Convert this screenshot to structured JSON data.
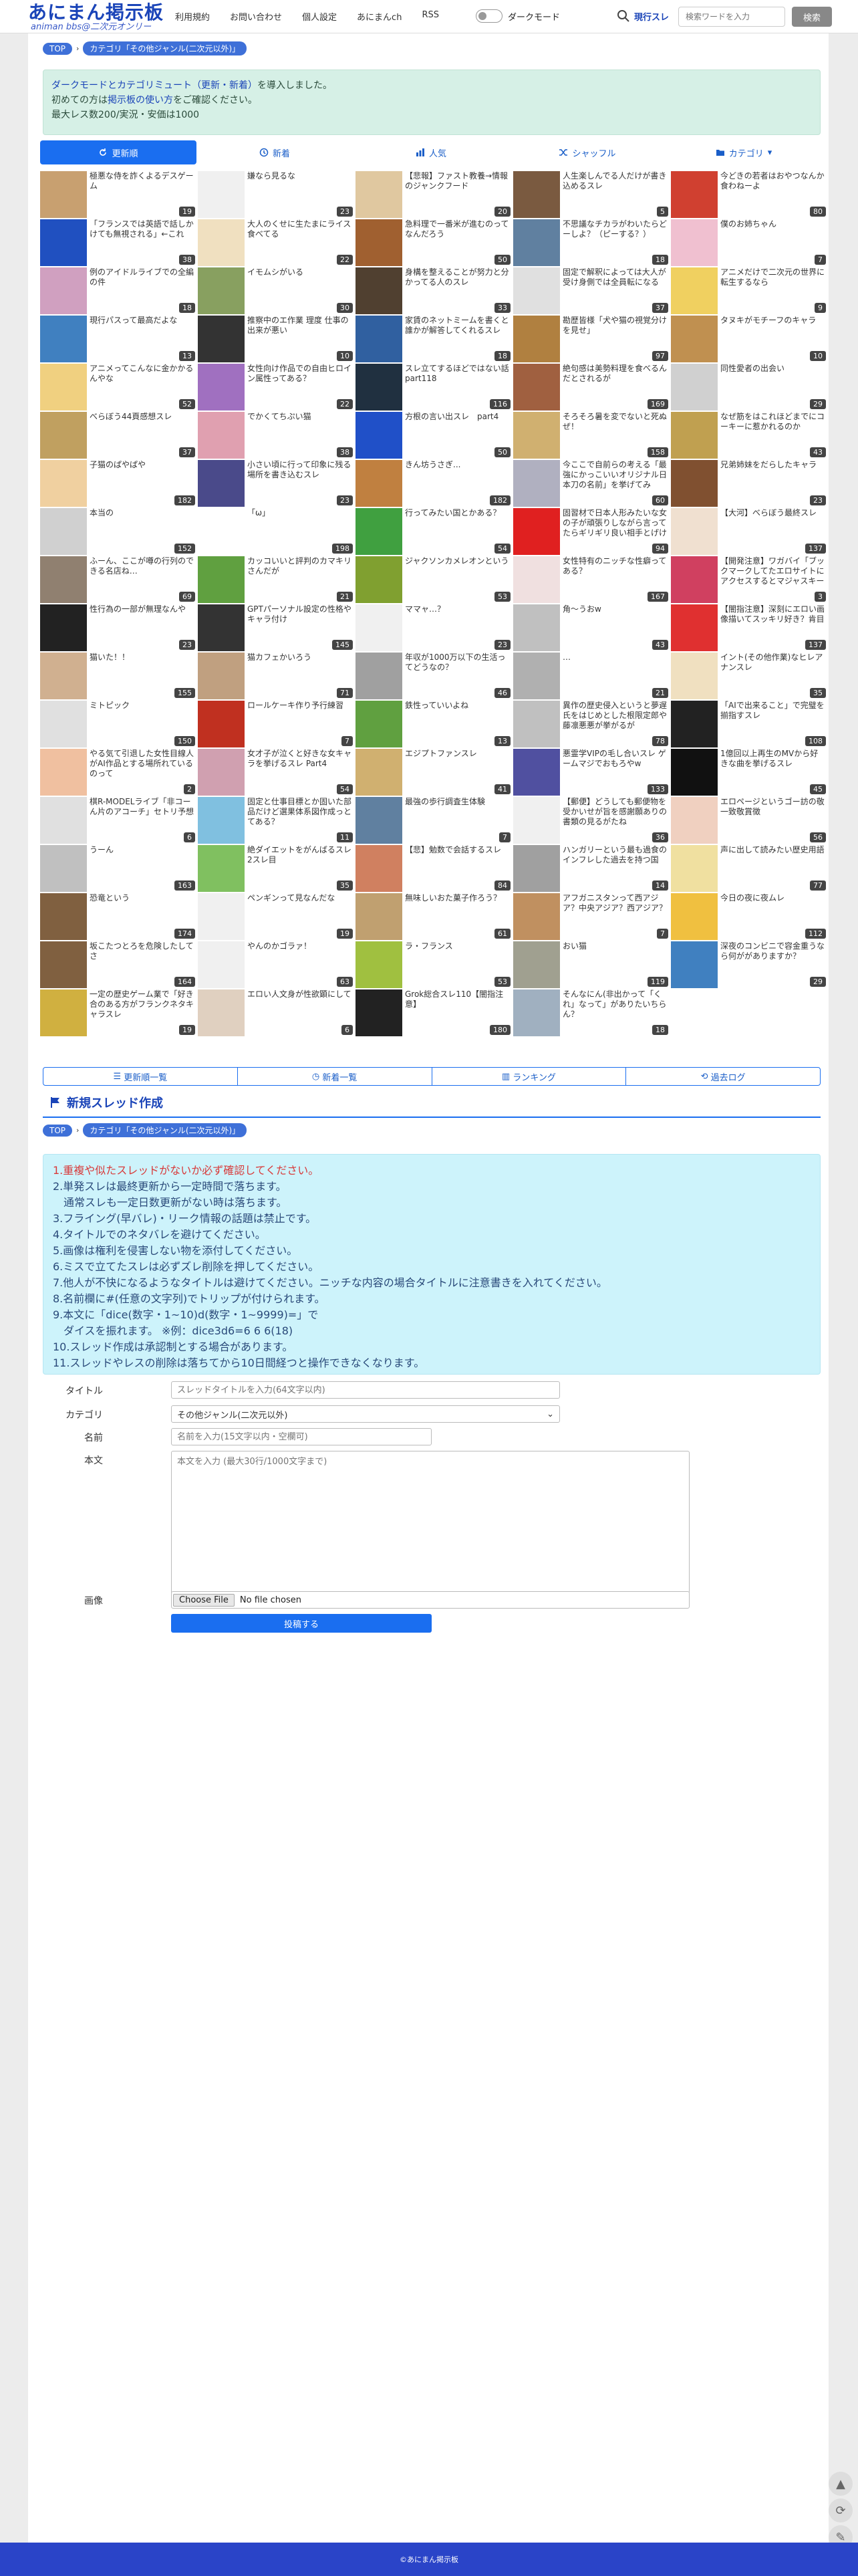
{
  "brand": {
    "title": "あにまん掲示板",
    "sub": "animan bbs@二次元オンリー"
  },
  "nav": {
    "items": [
      "利用規約",
      "お問い合わせ",
      "個人設定",
      "あにまんch",
      "RSS"
    ],
    "dark_label": "ダークモード"
  },
  "search": {
    "scope": "現行スレ",
    "placeholder": "検索ワードを入力",
    "button": "検索"
  },
  "breadcrumb": {
    "top": "TOP",
    "category": "カテゴリ「その他ジャンル(二次元以外)」"
  },
  "notice": {
    "line1_a": "ダークモードとカテゴリミュート（更新・新着）",
    "line1_b": "を導入しました。",
    "line2_a": "初めての方は",
    "line2_link": "掲示板の使い方",
    "line2_b": "をご確認ください。",
    "line3": "最大レス数200/実況・安価は1000"
  },
  "tabs": [
    "更新順",
    "新着",
    "人気",
    "シャッフル",
    "カテゴリ"
  ],
  "threads": [
    {
      "title": "極悪な侍を詐くよるデスゲーム",
      "count": "19",
      "color": "#c8a070"
    },
    {
      "title": "嫌なら見るな",
      "count": "23",
      "color": "#f0f0f0"
    },
    {
      "title": "【悲報】ファスト教養→情報のジャンクフード",
      "count": "20",
      "color": "#e0c8a0"
    },
    {
      "title": "人生楽しんでる人だけが書き込めるスレ",
      "count": "5",
      "color": "#7a5a40"
    },
    {
      "title": "今どきの若者はおやつなんか食わねーよ",
      "count": "80",
      "color": "#d04030"
    },
    {
      "title": "「フランスでは英語で話しかけても無視される」←これ",
      "count": "38",
      "color": "#2050c0"
    },
    {
      "title": "大人のくせに生たまにライス食べてる",
      "count": "22",
      "color": "#f0e0c0"
    },
    {
      "title": "急料理で一番米が進むのってなんだろう",
      "count": "50",
      "color": "#a06030"
    },
    {
      "title": "不思議なチカラがわいたらどーしよ？（ピーする？）",
      "count": "18",
      "color": "#6080a0"
    },
    {
      "title": "僕のお姉ちゃん",
      "count": "7",
      "color": "#f0c0d0"
    },
    {
      "title": "例のアイドルライブでの全編の件",
      "count": "18",
      "color": "#d0a0c0"
    },
    {
      "title": "イモムシがいる",
      "count": "30",
      "color": "#88a060"
    },
    {
      "title": "身構を整えることが努力と分かってる人のスレ",
      "count": "33",
      "color": "#504030"
    },
    {
      "title": "固定で解釈によっては大人が受け身側では全員転になる",
      "count": "37",
      "color": "#e0e0e0"
    },
    {
      "title": "アニメだけで二次元の世界に転生するなら",
      "count": "9",
      "color": "#f0d060"
    },
    {
      "title": "現行パスって最高だよな",
      "count": "13",
      "color": "#4080c0"
    },
    {
      "title": "推察中のエ作業 理度 仕事の出来が悪い",
      "count": "10",
      "color": "#333333"
    },
    {
      "title": "家賃のネットミームを書くと誰かが解答してくれるスレ",
      "count": "18",
      "color": "#3060a0"
    },
    {
      "title": "勘歴皆様「犬や猫の視覚分けを見せ」",
      "count": "97",
      "color": "#b08040"
    },
    {
      "title": "タヌキがモチーフのキャラ",
      "count": "10",
      "color": "#c09050"
    },
    {
      "title": "アニメってこんなに金かかるんやな",
      "count": "52",
      "color": "#f0d080"
    },
    {
      "title": "女性向け作品での自由ヒロイン属性ってある？",
      "count": "22",
      "color": "#a070c0"
    },
    {
      "title": "スレ立てするほどではない話part118",
      "count": "116",
      "color": "#203040"
    },
    {
      "title": "絶句感は美勢料理を食べるんだとされるが",
      "count": "169",
      "color": "#a06040"
    },
    {
      "title": "同性愛者の出会い",
      "count": "29",
      "color": "#d0d0d0"
    },
    {
      "title": "べらぼう44頁感想スレ",
      "count": "37",
      "color": "#c0a060"
    },
    {
      "title": "でかくてちぷい猫",
      "count": "38",
      "color": "#e0a0b0"
    },
    {
      "title": "方根の言い出スレ　part4",
      "count": "50",
      "color": "#2050c8"
    },
    {
      "title": "そろそろ暑を変でないと死ぬぜ！",
      "count": "158",
      "color": "#d0b070"
    },
    {
      "title": "なぜ筋をはこれほどまでにコーキーに惹かれるのか",
      "count": "43",
      "color": "#c0a050"
    },
    {
      "title": "子猫のぱやぱや",
      "count": "182",
      "color": "#f0d0a0"
    },
    {
      "title": "小さい頃に行って印象に残る場所を書き込むスレ",
      "count": "23",
      "color": "#4a4a8a"
    },
    {
      "title": "きん坊うさぎ...",
      "count": "182",
      "color": "#c08040"
    },
    {
      "title": "今ここで自前らの考える「最強にかっこいいオリジナル日本刀の名前」を挙げてみ",
      "count": "60",
      "color": "#b0b0c0"
    },
    {
      "title": "兄弟姉妹をだらしたキャラ",
      "count": "23",
      "color": "#805030"
    },
    {
      "title": "本当の",
      "count": "152",
      "color": "#d0d0d0"
    },
    {
      "title": "「ω」",
      "count": "198",
      "color": "#ffffff"
    },
    {
      "title": "行ってみたい国とかある？",
      "count": "54",
      "color": "#40a040"
    },
    {
      "title": "固習材で日本人形みたいな女の子が頑張りしながら言ってたらギリギリ良い相手とげけ",
      "count": "94",
      "color": "#e02020"
    },
    {
      "title": "【大河】べらぼう最終スレ",
      "count": "137",
      "color": "#f0e0d0"
    },
    {
      "title": "ふーん、ここが噂の行列のできる名店ね…",
      "count": "69",
      "color": "#908070"
    },
    {
      "title": "カッコいいと評判のカマキリさんだが",
      "count": "21",
      "color": "#60a040"
    },
    {
      "title": "ジャクソンカメレオンという",
      "count": "53",
      "color": "#80a030"
    },
    {
      "title": "女性特有のニッチな性癖ってある？",
      "count": "167",
      "color": "#f0e0e0"
    },
    {
      "title": "【開発注意】ワガバイ「ブックマークしてたエロサイトにアクセスするとマジャスキーん」",
      "count": "3",
      "color": "#d04060"
    },
    {
      "title": "性行為の一部が無理なんや",
      "count": "23",
      "color": "#222222"
    },
    {
      "title": "GPTパーソナル設定の性格やキャラ付け",
      "count": "145",
      "color": "#333333"
    },
    {
      "title": "ママャ…？",
      "count": "23",
      "color": "#f0f0f0"
    },
    {
      "title": "角～うおw",
      "count": "43",
      "color": "#c0c0c0"
    },
    {
      "title": "【闇指注意】深刻にエロい画像描いてスッキリ好き？肯目",
      "count": "137",
      "color": "#e03030"
    },
    {
      "title": "猫いた！！",
      "count": "155",
      "color": "#d0b090"
    },
    {
      "title": "猫カフェかいろう",
      "count": "71",
      "color": "#c0a080"
    },
    {
      "title": "年収が1000万以下の生活ってどうなの？",
      "count": "46",
      "color": "#a0a0a0"
    },
    {
      "title": "…",
      "count": "21",
      "color": "#b0b0b0"
    },
    {
      "title": "イント(その他作業)なヒレアナンスレ",
      "count": "35",
      "color": "#f0e0c0"
    },
    {
      "title": "ミトピック",
      "count": "150",
      "color": "#e0e0e0"
    },
    {
      "title": "ロールケーキ作り予行練習",
      "count": "7",
      "color": "#c03020"
    },
    {
      "title": "鉄性っていいよね",
      "count": "13",
      "color": "#60a040"
    },
    {
      "title": "異作の歴史侵入というと夢遅氏をはじめとした根限定郎や藤凛悪悪が挙がるが",
      "count": "78",
      "color": "#c0c0c0"
    },
    {
      "title": "「AIで出来ること」で完璧を揃指すスレ",
      "count": "108",
      "color": "#222222"
    },
    {
      "title": "やる気て引退した女性目線人がAI作品とする場所れているのって",
      "count": "2",
      "color": "#f0c0a0"
    },
    {
      "title": "女才子が泣くと好きな女キャラを挙げるスレ Part4",
      "count": "54",
      "color": "#d0a0b0"
    },
    {
      "title": "エジプトファンスレ",
      "count": "41",
      "color": "#d0b070"
    },
    {
      "title": "悪霊学VIPの毛し合いスレ ゲームマジでおもろやw",
      "count": "133",
      "color": "#5050a0"
    },
    {
      "title": "1億回以上再生のMVから好きな曲を挙げるスレ",
      "count": "45",
      "color": "#111111"
    },
    {
      "title": "棋R-MODELライブ「非コーん片のアコーチ」セトリ予想",
      "count": "6",
      "color": "#e0e0e0"
    },
    {
      "title": "固定と仕事目標とか固いた部品だけど選果体系図作成っとてある？",
      "count": "11",
      "color": "#80c0e0"
    },
    {
      "title": "最強の歩行調査生体験",
      "count": "7",
      "color": "#6080a0"
    },
    {
      "title": "【郵便】どうしても郵便物を受かいせが旨を感謝願ありの書類の見るがたね",
      "count": "36",
      "color": "#f0f0f0"
    },
    {
      "title": "エロページというゴー訪の敬一致敬賞徴",
      "count": "56",
      "color": "#f0d0c0"
    },
    {
      "title": "うーん",
      "count": "163",
      "color": "#c0c0c0"
    },
    {
      "title": "絶ダイエットをがんばるスレ　2スレ目",
      "count": "35",
      "color": "#80c060"
    },
    {
      "title": "【悲】勉数で会話するスレ",
      "count": "84",
      "color": "#d08060"
    },
    {
      "title": "ハンガリーという最も過食のインフレした過去を持つ国",
      "count": "14",
      "color": "#a0a0a0"
    },
    {
      "title": "声に出して読みたい歴史用語",
      "count": "77",
      "color": "#f0e0a0"
    },
    {
      "title": "恐竜という",
      "count": "174",
      "color": "#806040"
    },
    {
      "title": "ペンギンって見なんだな",
      "count": "19",
      "color": "#f0f0f0"
    },
    {
      "title": "無味しいおた菓子作ろう？",
      "count": "61",
      "color": "#c0a070"
    },
    {
      "title": "アフガニスタンって西アジア？中央アジア？西アジア？",
      "count": "7",
      "color": "#c09060"
    },
    {
      "title": "今日の夜に夜ムレ",
      "count": "112",
      "color": "#f0c040"
    },
    {
      "title": "坂こたつとろを危険したしてさ",
      "count": "164",
      "color": "#806040"
    },
    {
      "title": "やんのかゴラァ！",
      "count": "63",
      "color": "#f0f0f0"
    },
    {
      "title": "ラ・フランス",
      "count": "53",
      "color": "#a0c040"
    },
    {
      "title": "おい猫",
      "count": "119",
      "color": "#a0a090"
    },
    {
      "title": "深夜のコンビニで容金重うなら何ががありますか？",
      "count": "29",
      "color": "#4080c0"
    },
    {
      "title": "一定の歴史ゲーム業で「好き合のある方がフランクネタキャラスレ",
      "count": "19",
      "color": "#d0b040"
    },
    {
      "title": "エロい人文身が性欲顕にして",
      "count": "6",
      "color": "#e0d0c0"
    },
    {
      "title": "Grok総合スレ110【闇指注意】",
      "count": "180",
      "color": "#222222"
    },
    {
      "title": "そんなにん(非出かって「くれ」なって」がありたいちらん？",
      "count": "18",
      "color": "#a0b0c0"
    }
  ],
  "subnav": [
    "更新順一覧",
    "新着一覧",
    "ランキング",
    "過去ログ"
  ],
  "new_thread": {
    "heading": "新規スレッド作成"
  },
  "rules": [
    {
      "text": "1.重複や似たスレッドがないか必ず確認してください。",
      "red": true
    },
    {
      "text": "2.単発スレは最終更新から一定時間で落ちます。",
      "red": false
    },
    {
      "text": "　通常スレも一定日数更新がない時は落ちます。",
      "red": false
    },
    {
      "text": "3.フライング(早バレ)・リーク情報の話題は禁止です。",
      "red": false
    },
    {
      "text": "4.タイトルでのネタバレを避けてください。",
      "red": false
    },
    {
      "text": "5.画像は権利を侵害しない物を添付してください。",
      "red": false
    },
    {
      "text": "6.ミスで立てたスレは必ずズレ削除を押してください。",
      "red": false
    },
    {
      "text": "7.他人が不快になるようなタイトルは避けてください。ニッチな内容の場合タイトルに注意書きを入れてください。",
      "red": false
    },
    {
      "text": "8.名前欄に#(任意の文字列)でトリップが付けられます。",
      "red": false
    },
    {
      "text": "9.本文に「dice(数字・1~10)d(数字・1~9999)=」で",
      "red": false
    },
    {
      "text": "　ダイスを振れます。 ※例：dice3d6=6 6 6(18)",
      "red": false
    },
    {
      "text": "10.スレッド作成は承認制とする場合があります。",
      "red": false
    },
    {
      "text": "11.スレッドやレスの削除は落ちてから10日間経つと操作できなくなります。",
      "red": false
    }
  ],
  "form": {
    "title_label": "タイトル",
    "title_placeholder": "スレッドタイトルを入力(64文字以内)",
    "category_label": "カテゴリ",
    "category_value": "その他ジャンル(二次元以外)",
    "name_label": "名前",
    "name_placeholder": "名前を入力(15文字以内・空欄可)",
    "body_label": "本文",
    "body_placeholder": "本文を入力 (最大30行/1000文字まで)",
    "image_label": "画像",
    "file_button": "Choose File",
    "file_status": "No file chosen",
    "submit": "投稿する"
  },
  "footer": {
    "text": "©あにまん掲示板"
  }
}
